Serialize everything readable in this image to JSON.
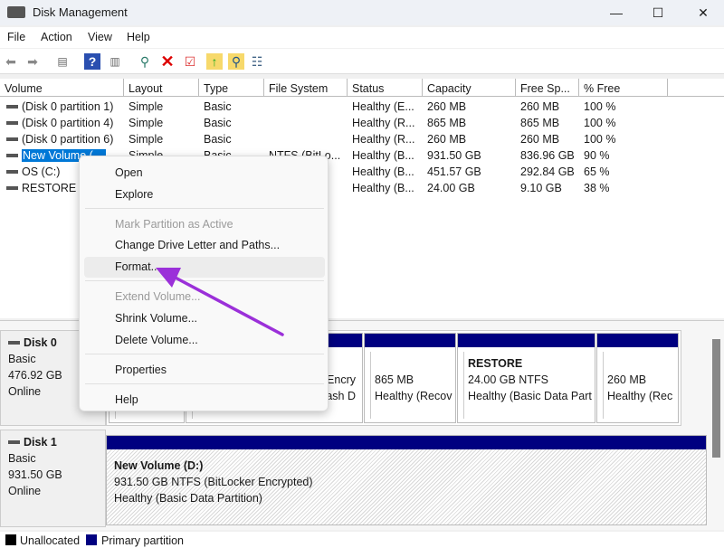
{
  "window": {
    "title": "Disk Management",
    "controls": [
      "—",
      "☐",
      "✕"
    ]
  },
  "menu": [
    "File",
    "Action",
    "View",
    "Help"
  ],
  "toolbar": [
    "back-icon",
    "forward-icon",
    "console-tree-icon",
    "help-icon",
    "show-hide-icon",
    "connect-drive-icon",
    "delete-icon",
    "check-icon",
    "folder-up-icon",
    "folder-search-icon",
    "properties-icon"
  ],
  "table": {
    "columns": [
      "Volume",
      "Layout",
      "Type",
      "File System",
      "Status",
      "Capacity",
      "Free Sp...",
      "% Free"
    ],
    "rows": [
      [
        "(Disk 0 partition 1)",
        "Simple",
        "Basic",
        "",
        "Healthy (E...",
        "260 MB",
        "260 MB",
        "100 %"
      ],
      [
        "(Disk 0 partition 4)",
        "Simple",
        "Basic",
        "",
        "Healthy (R...",
        "865 MB",
        "865 MB",
        "100 %"
      ],
      [
        "(Disk 0 partition 6)",
        "Simple",
        "Basic",
        "",
        "Healthy (R...",
        "260 MB",
        "260 MB",
        "100 %"
      ],
      [
        "New Volume (",
        "Simple",
        "Basic",
        "NTFS (BitLo...",
        "Healthy (B...",
        "931.50 GB",
        "836.96 GB",
        "90 %"
      ],
      [
        "OS (C:)",
        "",
        "",
        "",
        "Healthy (B...",
        "451.57 GB",
        "292.84 GB",
        "65 %"
      ],
      [
        "RESTORE",
        "",
        "",
        "",
        "Healthy (B...",
        "24.00 GB",
        "9.10 GB",
        "38 %"
      ]
    ]
  },
  "disks": [
    {
      "name": "Disk 0",
      "type": "Basic",
      "size": "476.92 GB",
      "status": "Online",
      "partitions": [
        {
          "title": "",
          "l1": "",
          "l2": ""
        },
        {
          "title": "",
          "l1": "Encry",
          "l2": "rash D"
        },
        {
          "title": "",
          "l1": "865 MB",
          "l2": "Healthy (Recov"
        },
        {
          "title": "RESTORE",
          "l1": "24.00 GB NTFS",
          "l2": "Healthy (Basic Data Parti"
        },
        {
          "title": "",
          "l1": "260 MB",
          "l2": "Healthy (Rec"
        }
      ]
    },
    {
      "name": "Disk 1",
      "type": "Basic",
      "size": "931.50 GB",
      "status": "Online",
      "partitions": [
        {
          "title": "New Volume  (D:)",
          "l1": "931.50 GB NTFS (BitLocker Encrypted)",
          "l2": "Healthy (Basic Data Partition)"
        }
      ]
    }
  ],
  "legend": [
    {
      "label": "Unallocated",
      "color": "#000000"
    },
    {
      "label": "Primary partition",
      "color": "#000080"
    }
  ],
  "context_menu": [
    {
      "label": "Open",
      "disabled": false
    },
    {
      "label": "Explore",
      "disabled": false
    },
    {
      "label": "Mark Partition as Active",
      "disabled": true
    },
    {
      "label": "Change Drive Letter and Paths...",
      "disabled": false
    },
    {
      "label": "Format...",
      "disabled": false,
      "hover": true
    },
    {
      "label": "Extend Volume...",
      "disabled": true
    },
    {
      "label": "Shrink Volume...",
      "disabled": false
    },
    {
      "label": "Delete Volume...",
      "disabled": false
    },
    {
      "label": "Properties",
      "disabled": false
    },
    {
      "label": "Help",
      "disabled": false
    }
  ],
  "colors": {
    "selection": "#0078d7",
    "partition_bar": "#000080",
    "annotation_arrow": "#9b30d9"
  }
}
